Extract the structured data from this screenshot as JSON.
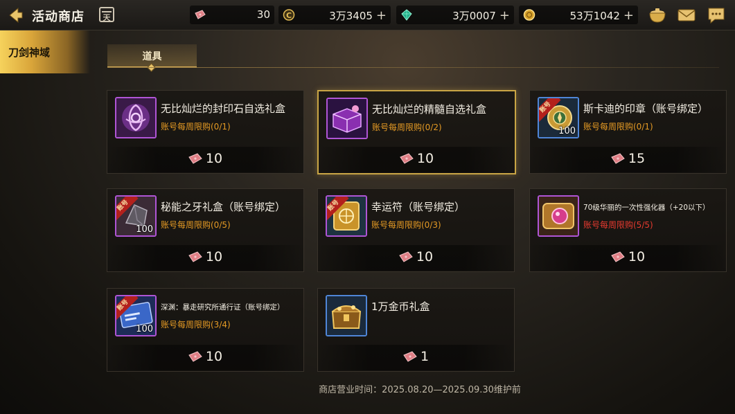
{
  "header": {
    "title": "活动商店",
    "calendar_glyph": "天",
    "currencies": [
      {
        "name": "ticket-icon",
        "value": "30",
        "plus": ""
      },
      {
        "name": "coin-c-icon",
        "value": "3万3405",
        "plus": "+"
      },
      {
        "name": "green-gem-icon",
        "value": "3万0007",
        "plus": "+"
      },
      {
        "name": "gold-coin-icon",
        "value": "53万1042",
        "plus": "+"
      }
    ]
  },
  "sidebar": {
    "tab_label": "刀剑神域"
  },
  "category": {
    "tab_label": "道具"
  },
  "items": [
    {
      "name": "无比灿烂的封印石自选礼盒",
      "limit": "账号每周限购(0/1)",
      "price": "10",
      "badge": "",
      "qty": ""
    },
    {
      "name": "无比灿烂的精髓自选礼盒",
      "limit": "账号每周限购(0/2)",
      "price": "10",
      "badge": "",
      "qty": ""
    },
    {
      "name": "斯卡迪的印章（账号绑定）",
      "limit": "账号每周限购(0/1)",
      "price": "15",
      "badge": "账号",
      "qty": "100"
    },
    {
      "name": "秘能之牙礼盒（账号绑定）",
      "limit": "账号每周限购(0/5)",
      "price": "10",
      "badge": "账号",
      "qty": "100"
    },
    {
      "name": "幸运符（账号绑定）",
      "limit": "账号每周限购(0/3)",
      "price": "10",
      "badge": "账号",
      "qty": ""
    },
    {
      "name": "70级华丽的一次性强化器（+20以下）",
      "limit": "账号每周限购(5/5)",
      "price": "10",
      "badge": "",
      "qty": ""
    },
    {
      "name": "深渊：暴走研究所通行证（账号绑定）",
      "limit": "账号每周限购(3/4)",
      "price": "10",
      "badge": "账号",
      "qty": "100"
    },
    {
      "name": "1万金币礼盒",
      "limit": "",
      "price": "1",
      "badge": "",
      "qty": ""
    }
  ],
  "footer": {
    "shop_hours": "商店营业时间：2025.08.20—2025.09.30维护前"
  },
  "colors": {
    "accent_gold": "#d7ad57",
    "limit_orange": "#e59a24",
    "limit_full_red": "#e63a2f",
    "rarity_purple": "#b055d6",
    "rarity_blue": "#4f86d8"
  }
}
